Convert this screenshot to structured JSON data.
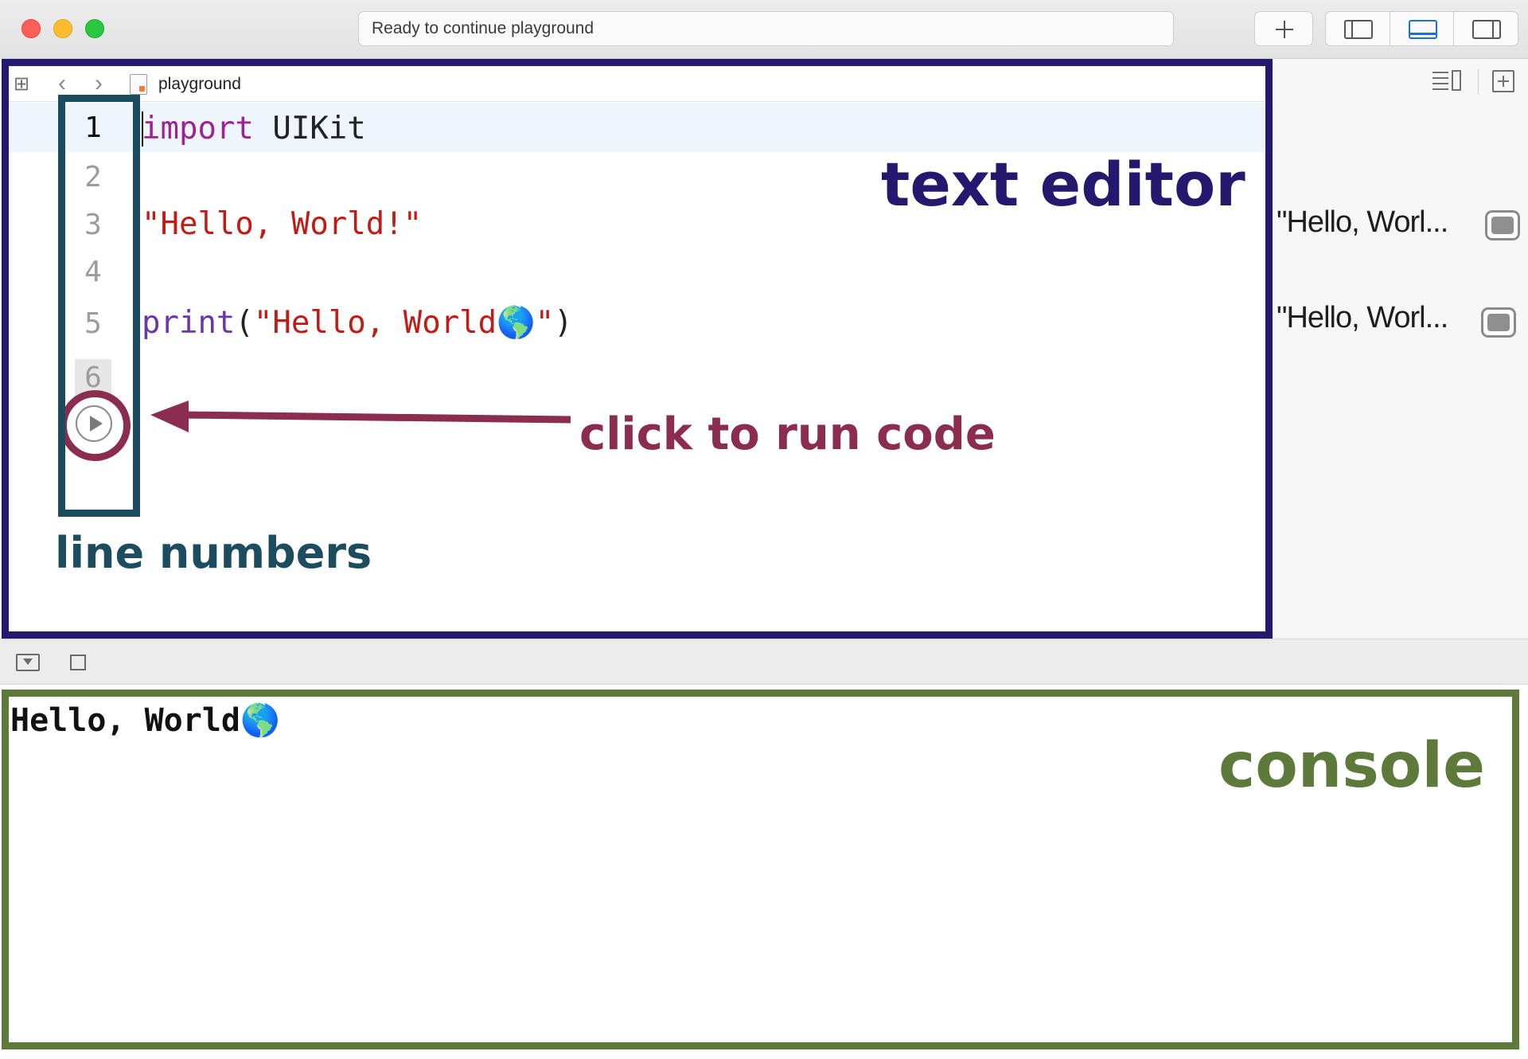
{
  "window": {
    "status_text": "Ready to continue playground",
    "toolbar": {
      "add_icon": "plus-icon",
      "panes": [
        "navigator-pane-icon",
        "debug-pane-icon",
        "inspector-pane-icon"
      ]
    }
  },
  "jumpbar": {
    "file_name": "playground"
  },
  "editor": {
    "line_numbers": [
      "1",
      "2",
      "3",
      "4",
      "5",
      "6"
    ],
    "lines": [
      {
        "keyword": "import",
        "rest": " UIKit"
      },
      {
        "text": ""
      },
      {
        "string": "\"Hello, World!\""
      },
      {
        "text": ""
      },
      {
        "function": "print",
        "open": "(",
        "string": "\"Hello, World🌎\"",
        "close": ")"
      },
      {
        "text": ""
      }
    ]
  },
  "results": [
    {
      "text": "\"Hello, Worl..."
    },
    {
      "text": "\"Hello, Worl..."
    }
  ],
  "console": {
    "output": "Hello, World🌎"
  },
  "annotations": {
    "text_editor": "text editor",
    "run_code": "click to run code",
    "line_numbers": "line numbers",
    "console": "console"
  },
  "colors": {
    "editor_frame": "#24196e",
    "line_numbers_frame": "#1b4c5f",
    "run_annotation": "#8b2d4f",
    "console_frame": "#5d7a3a",
    "keyword": "#9b2393",
    "string": "#c41a16",
    "function": "#6c36a9"
  }
}
